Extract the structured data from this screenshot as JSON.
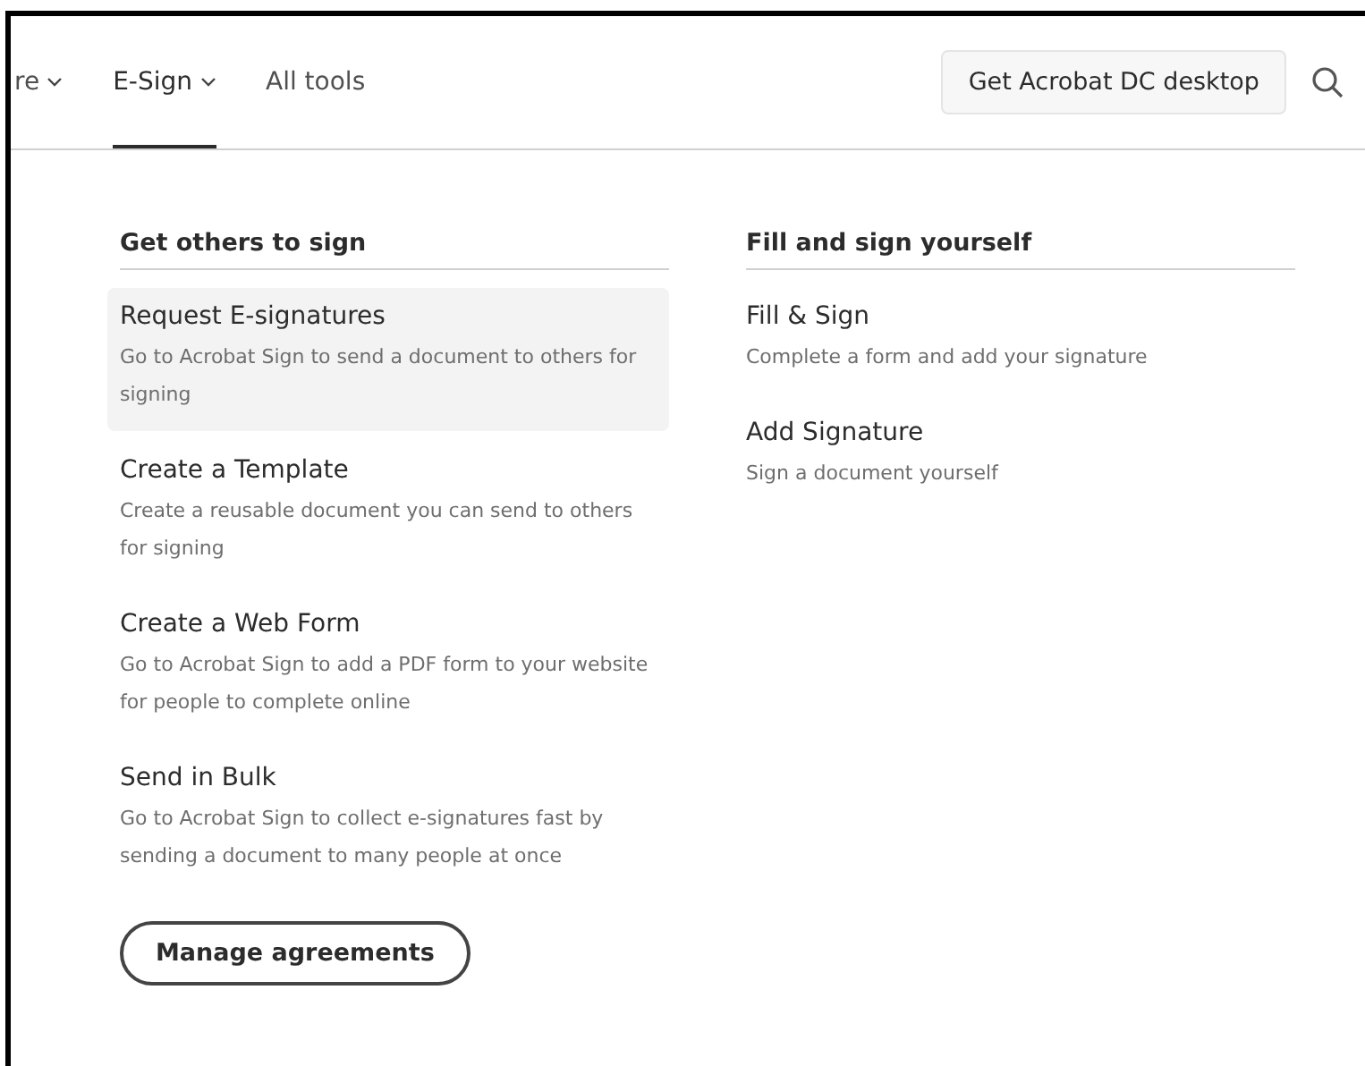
{
  "nav": {
    "items": [
      {
        "label": "re",
        "dropdown": true,
        "selected": false
      },
      {
        "label": "E-Sign",
        "dropdown": true,
        "selected": true
      },
      {
        "label": "All tools",
        "dropdown": false,
        "selected": false
      }
    ],
    "cta": "Get Acrobat DC desktop"
  },
  "columns": [
    {
      "heading": "Get others to sign",
      "items": [
        {
          "title": "Request E-signatures",
          "description": "Go to Acrobat Sign to send a document to others for signing",
          "selected": true
        },
        {
          "title": "Create a Template",
          "description": "Create a reusable document you can send to others for signing",
          "selected": false
        },
        {
          "title": "Create a Web Form",
          "description": "Go to Acrobat Sign to add a PDF form to your website for people to complete online",
          "selected": false
        },
        {
          "title": "Send in Bulk",
          "description": "Go to Acrobat Sign to collect e-signatures fast by sending a document to many people at once",
          "selected": false
        }
      ],
      "button": "Manage agreements"
    },
    {
      "heading": "Fill and sign yourself",
      "items": [
        {
          "title": "Fill & Sign",
          "description": "Complete a form and add your signature",
          "selected": false
        },
        {
          "title": "Add Signature",
          "description": "Sign a document yourself",
          "selected": false
        }
      ]
    }
  ]
}
